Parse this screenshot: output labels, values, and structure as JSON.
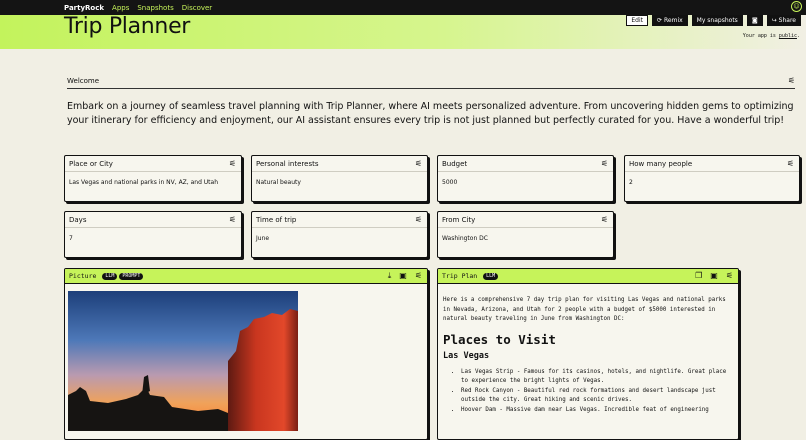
{
  "nav": {
    "brand": "PartyRock",
    "links": [
      "Apps",
      "Snapshots",
      "Discover"
    ]
  },
  "header": {
    "title": "Trip Planner",
    "actions": {
      "edit": "Edit",
      "remix": "Remix",
      "my_snapshots": "My snapshots",
      "share": "Share"
    },
    "public_prefix": "Your app is ",
    "public_word": "public",
    "public_suffix": "."
  },
  "welcome": {
    "label": "Welcome",
    "text": "Embark on a journey of seamless travel planning with Trip Planner, where AI meets personalized adventure. From uncovering hidden gems to optimizing your itinerary for efficiency and enjoyment, our AI assistant ensures every trip is not just planned but perfectly curated for you. Have a wonderful trip!"
  },
  "inputs": [
    {
      "label": "Place or City",
      "value": "Las Vegas and national parks in NV, AZ, and Utah"
    },
    {
      "label": "Personal interests",
      "value": "Natural beauty"
    },
    {
      "label": "Budget",
      "value": "5000"
    },
    {
      "label": "How many people",
      "value": "2"
    },
    {
      "label": "Days",
      "value": "7"
    },
    {
      "label": "Time of trip",
      "value": "June"
    },
    {
      "label": "From City",
      "value": "Washington DC"
    }
  ],
  "picture": {
    "title": "Picture",
    "badges": [
      "LLM",
      "PROMPT"
    ]
  },
  "trip_plan": {
    "title": "Trip Plan",
    "badge": "LLM",
    "intro": "Here is a comprehensive 7 day trip plan for visiting Las Vegas and national parks in Nevada, Arizona, and Utah for 2 people with a budget of $5000 interested in natural beauty traveling in June from Washington DC:",
    "h2": "Places to Visit",
    "h3": "Las Vegas",
    "items": [
      "Las Vegas Strip - Famous for its casinos, hotels, and nightlife. Great place to experience the bright lights of Vegas.",
      "Red Rock Canyon - Beautiful red rock formations and desert landscape just outside the city. Great hiking and scenic drives.",
      "Hoover Dam - Massive dam near Las Vegas. Incredible feat of engineering"
    ]
  },
  "colors": {
    "accent": "#c6f35a",
    "dark": "#141414",
    "background": "#f1efe4"
  },
  "icons": [
    "smiley-icon",
    "settings-sliders-icon",
    "download-icon",
    "save-icon",
    "copy-icon",
    "camera-icon",
    "share-arrow-icon",
    "remix-icon"
  ]
}
